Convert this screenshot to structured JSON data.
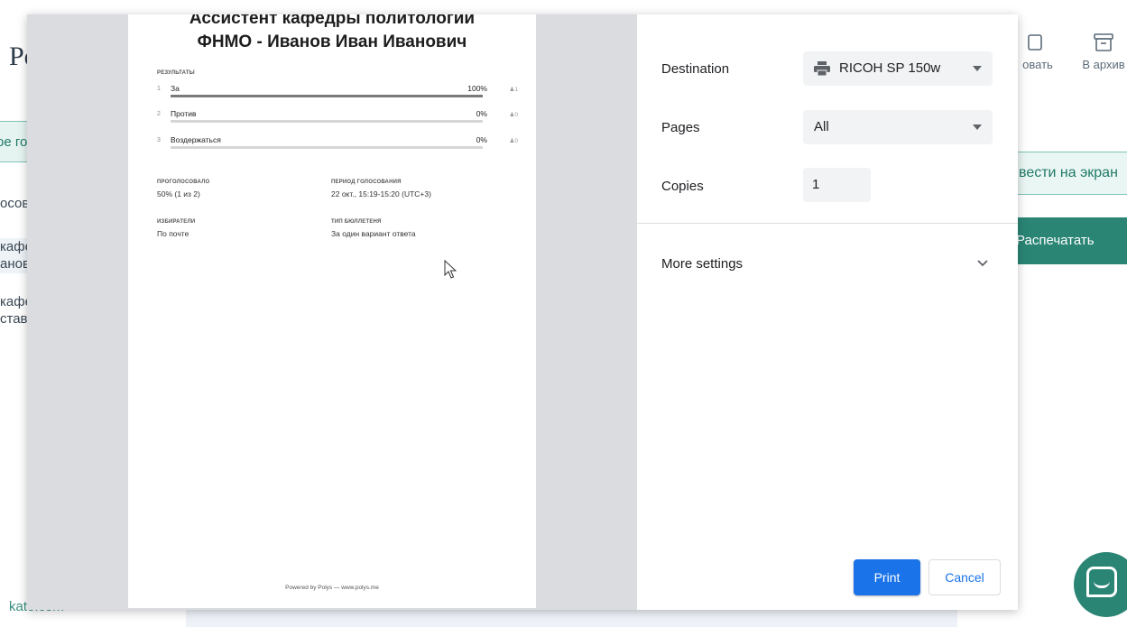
{
  "background": {
    "logo": "Po",
    "left_tab": "ое го",
    "left_items": [
      "осова",
      "кафе",
      "анов",
      "кафе",
      "став"
    ],
    "toolbar": {
      "edit_label": "овать",
      "archive_label": "В архив"
    },
    "show_on_screen_label": "вести на экран",
    "print_label": "Распечатать",
    "footer_link": "kate.com"
  },
  "preview": {
    "title_line1": "Ассистент кафедры политологии",
    "title_line2": "ФНМО - Иванов Иван Иванович",
    "results_label": "РЕЗУЛЬТАТЫ",
    "results": [
      {
        "num": "1",
        "option": "За",
        "percent": "100%",
        "votes": "1",
        "fraction": 1.0
      },
      {
        "num": "2",
        "option": "Против",
        "percent": "0%",
        "votes": "0",
        "fraction": 0.0
      },
      {
        "num": "3",
        "option": "Воздержаться",
        "percent": "0%",
        "votes": "0",
        "fraction": 0.0
      }
    ],
    "voted_label": "ПРОГОЛОСОВАЛО",
    "voted_value": "50% (1 из 2)",
    "period_label": "ПЕРИОД ГОЛОСОВАНИЯ",
    "period_value": "22 окт., 15:19-15:20 (UTC+3)",
    "voters_label": "ИЗБИРАТЕЛИ",
    "voters_value": "По почте",
    "ballot_label": "ТИП БЮЛЛЕТЕНЯ",
    "ballot_value": "За один вариант ответа",
    "footer": "Powered by Polys — www.polys.me"
  },
  "settings": {
    "destination_label": "Destination",
    "destination_value": "RICOH SP 150w",
    "pages_label": "Pages",
    "pages_value": "All",
    "copies_label": "Copies",
    "copies_value": "1",
    "more_settings_label": "More settings",
    "print_button": "Print",
    "cancel_button": "Cancel"
  }
}
